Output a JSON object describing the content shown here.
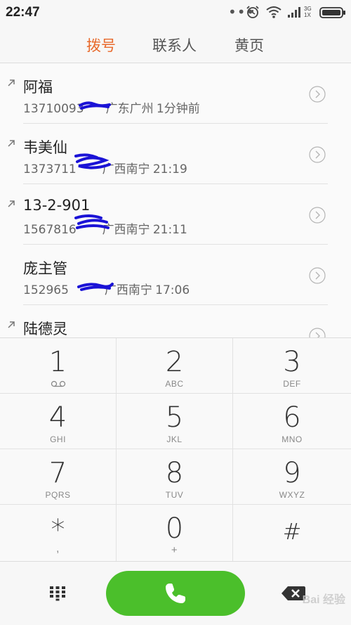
{
  "status_bar": {
    "time": "22:47",
    "network_top": "3G",
    "network_bottom": "1X",
    "icons": [
      "more-dots-icon",
      "alarm-icon",
      "wifi-icon",
      "signal-icon",
      "battery-icon"
    ]
  },
  "tabs": [
    {
      "label": "拨号",
      "active": true
    },
    {
      "label": "联系人",
      "active": false
    },
    {
      "label": "黄页",
      "active": false
    }
  ],
  "call_log": [
    {
      "name": "阿福",
      "number": "13710093",
      "location": "广东广州",
      "time": "1分钟前",
      "outgoing": true
    },
    {
      "name": "韦美仙",
      "number": "1373711",
      "location": "广西南宁",
      "time": "21:19",
      "outgoing": true
    },
    {
      "name": "13-2-901",
      "number": "1567816",
      "location": "广西南宁",
      "time": "21:11",
      "outgoing": true
    },
    {
      "name": "庞主管",
      "number": "152965",
      "location": "广西南宁",
      "time": "17:06",
      "outgoing": false
    },
    {
      "name": "陆德灵",
      "number": "",
      "location": "",
      "time": "",
      "outgoing": true
    }
  ],
  "keypad": [
    {
      "digit": "1",
      "letters": ""
    },
    {
      "digit": "2",
      "letters": "ABC"
    },
    {
      "digit": "3",
      "letters": "DEF"
    },
    {
      "digit": "4",
      "letters": "GHI"
    },
    {
      "digit": "5",
      "letters": "JKL"
    },
    {
      "digit": "6",
      "letters": "MNO"
    },
    {
      "digit": "7",
      "letters": "PQRS"
    },
    {
      "digit": "8",
      "letters": "TUV"
    },
    {
      "digit": "9",
      "letters": "WXYZ"
    },
    {
      "digit": "*",
      "letters": ","
    },
    {
      "digit": "0",
      "letters": "+"
    },
    {
      "digit": "#",
      "letters": ""
    }
  ],
  "bottom_bar": {
    "watermark": "Bai 经验"
  },
  "colors": {
    "accent": "#e86a2c",
    "call_green": "#4bbf2b",
    "scribble": "#1a12d6"
  }
}
